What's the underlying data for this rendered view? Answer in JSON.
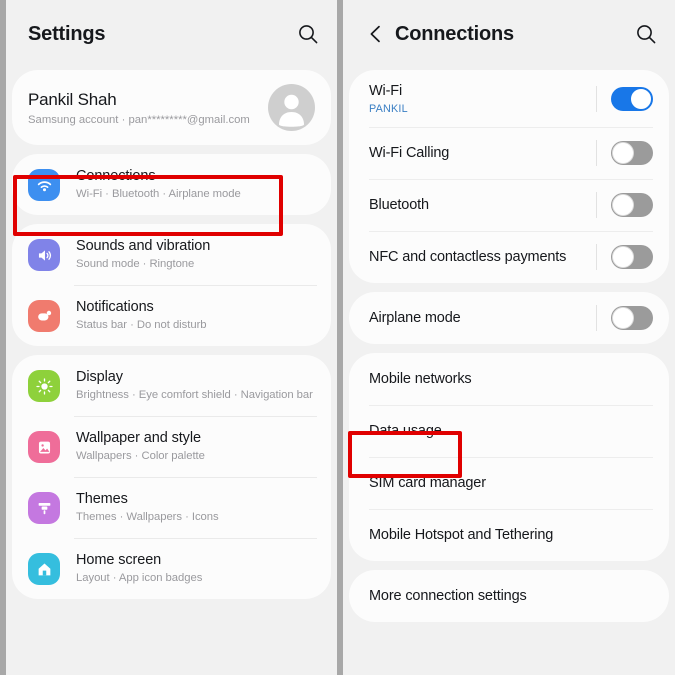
{
  "left_panel": {
    "header": {
      "title": "Settings",
      "search_icon": "search-icon"
    },
    "profile": {
      "name": "Pankil Shah",
      "subtitle": "Samsung account  ·  pan*********@gmail.com",
      "avatar_icon": "person-avatar-icon"
    },
    "groups": [
      {
        "items": [
          {
            "title": "Connections",
            "subtitle": "Wi-Fi  ·  Bluetooth  ·  Airplane mode",
            "icon": "wifi-icon",
            "icon_color": "#3d8ff0",
            "highlighted": true
          }
        ]
      },
      {
        "items": [
          {
            "title": "Sounds and vibration",
            "subtitle": "Sound mode  ·  Ringtone",
            "icon": "speaker-icon",
            "icon_color": "#8083e8"
          },
          {
            "title": "Notifications",
            "subtitle": "Status bar  ·  Do not disturb",
            "icon": "notification-bubble-icon",
            "icon_color": "#f07b6e"
          }
        ]
      },
      {
        "items": [
          {
            "title": "Display",
            "subtitle": "Brightness  ·  Eye comfort shield  ·  Navigation bar",
            "icon": "brightness-sun-icon",
            "icon_color": "#8ed13b"
          },
          {
            "title": "Wallpaper and style",
            "subtitle": "Wallpapers  ·  Color palette",
            "icon": "image-picture-icon",
            "icon_color": "#ef6d99"
          },
          {
            "title": "Themes",
            "subtitle": "Themes  ·  Wallpapers  ·  Icons",
            "icon": "paint-brush-icon",
            "icon_color": "#c478e0"
          },
          {
            "title": "Home screen",
            "subtitle": "Layout  ·  App icon badges",
            "icon": "home-icon",
            "icon_color": "#35bede"
          }
        ]
      }
    ]
  },
  "right_panel": {
    "header": {
      "back_icon": "back-chevron-icon",
      "title": "Connections",
      "search_icon": "search-icon"
    },
    "groups": [
      {
        "items": [
          {
            "title": "Wi-Fi",
            "subtitle": "PANKIL",
            "toggle": "on"
          },
          {
            "title": "Wi-Fi Calling",
            "toggle": "off"
          },
          {
            "title": "Bluetooth",
            "toggle": "off"
          },
          {
            "title": "NFC and contactless payments",
            "toggle": "off"
          }
        ]
      },
      {
        "items": [
          {
            "title": "Airplane mode",
            "toggle": "off"
          }
        ]
      },
      {
        "items": [
          {
            "title": "Mobile networks"
          },
          {
            "title": "Data usage",
            "highlighted": true
          },
          {
            "title": "SIM card manager"
          },
          {
            "title": "Mobile Hotspot and Tethering"
          }
        ]
      },
      {
        "items": [
          {
            "title": "More connection settings"
          }
        ]
      }
    ]
  },
  "annotations": {
    "highlight_color": "#e00000",
    "boxes": [
      {
        "name": "connections-highlight",
        "target": "Connections"
      },
      {
        "name": "data-usage-highlight",
        "target": "Data usage"
      }
    ]
  }
}
